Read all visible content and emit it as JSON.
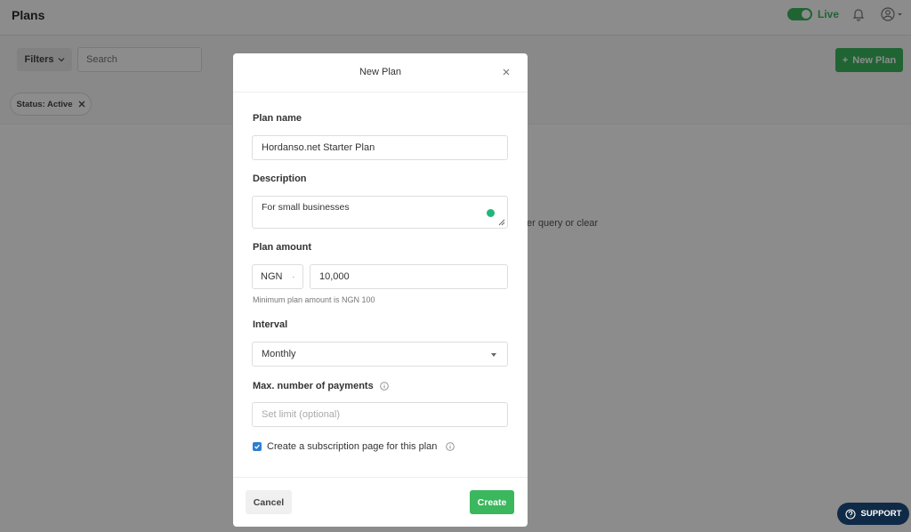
{
  "app": {
    "page_title": "Plans",
    "live_label": "Live",
    "filters_label": "Filters",
    "search_placeholder": "Search",
    "new_plan_label": "New Plan",
    "status_chip": "Status: Active",
    "empty_text": "er query or clear",
    "support_label": "SUPPORT",
    "accent_color": "#3bb75e"
  },
  "modal": {
    "title": "New Plan",
    "plan_name_label": "Plan name",
    "plan_name_value": "Hordanso.net Starter Plan",
    "description_label": "Description",
    "description_value": "For small businesses",
    "plan_amount_label": "Plan amount",
    "currency": "NGN",
    "amount_value": "10,000",
    "amount_hint": "Minimum plan amount is NGN 100",
    "interval_label": "Interval",
    "interval_value": "Monthly",
    "max_payments_label": "Max. number of payments",
    "max_payments_placeholder": "Set limit (optional)",
    "subscription_page_label": "Create a subscription page for this plan",
    "subscription_page_checked": true,
    "cancel_label": "Cancel",
    "create_label": "Create"
  }
}
